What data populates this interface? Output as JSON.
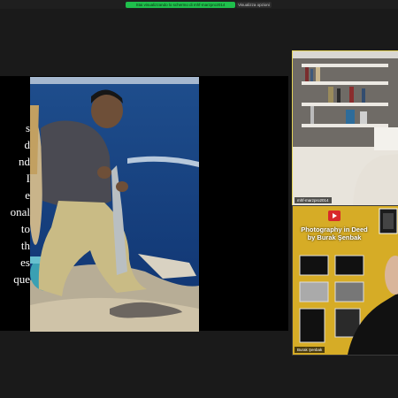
{
  "top_bar": {
    "share_banner": "Stai visualizzando lo schermo di mhf-marzpro2014",
    "view_options": "Visualizza opzioni"
  },
  "slide": {
    "text_lines": [
      "",
      "s",
      "",
      "d",
      "nd",
      "I",
      "",
      "e",
      "onal",
      "to",
      "th",
      "es",
      "que"
    ]
  },
  "participants": [
    {
      "name": "mhf-marzpro2014"
    },
    {
      "name": "Burak Şenbak"
    }
  ],
  "shared_card": {
    "title_line1": "Photography in Deed",
    "title_line2": "by Burak Şenbak"
  },
  "colors": {
    "share_banner_green": "#1fbf4c",
    "active_speaker_border": "#e3d35a",
    "card_background": "#e0b82a"
  }
}
